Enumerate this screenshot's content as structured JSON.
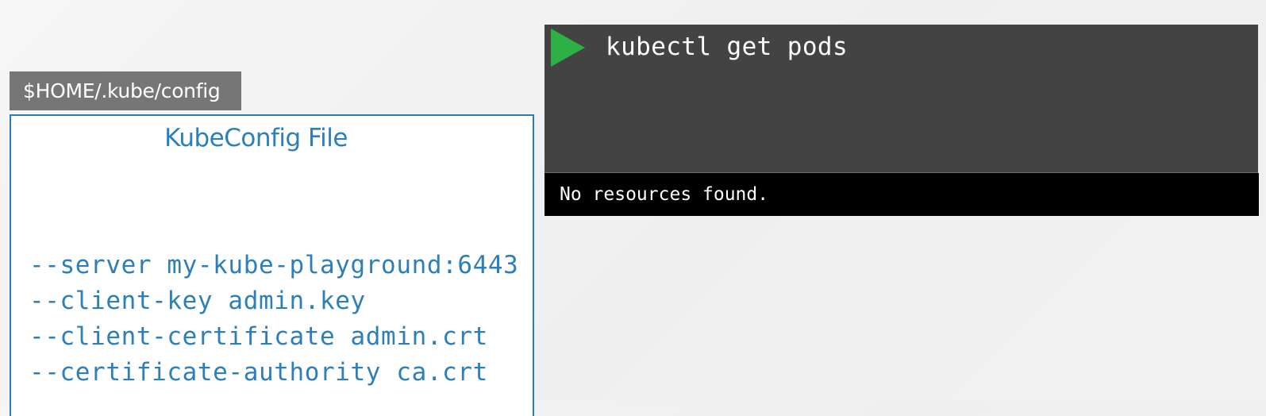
{
  "path_label": "$HOME/.kube/config",
  "kubeconfig": {
    "title": "KubeConfig File",
    "lines": [
      "--server my-kube-playground:6443",
      "--client-key admin.key",
      "--client-certificate admin.crt",
      "--certificate-authority ca.crt"
    ]
  },
  "terminal": {
    "play_icon": "play-icon",
    "command": "kubectl get pods",
    "output": "No resources found."
  },
  "colors": {
    "accent_blue": "#2c7fb8",
    "terminal_bg": "#434343",
    "output_bg": "#000000",
    "play_green": "#2db145",
    "tab_gray": "#767676"
  }
}
